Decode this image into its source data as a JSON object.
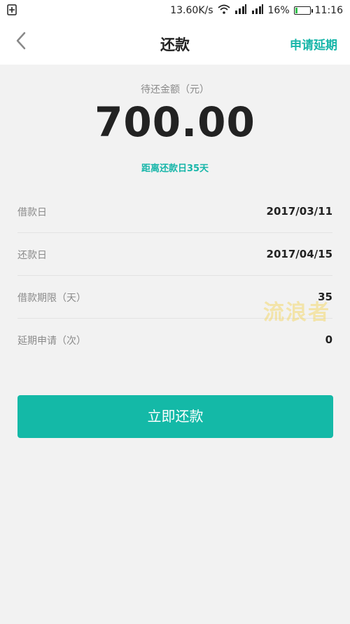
{
  "status_bar": {
    "speed": "13.60K/s",
    "battery_percent": "16%",
    "time": "11:16",
    "battery_level": 0.16
  },
  "header": {
    "title": "还款",
    "action": "申请延期",
    "back_icon": "chevron-left-icon"
  },
  "amount": {
    "label": "待还金额（元）",
    "value": "700.00",
    "due_text": "距离还款日35天"
  },
  "info": [
    {
      "label": "借款日",
      "value": "2017/03/11"
    },
    {
      "label": "还款日",
      "value": "2017/04/15"
    },
    {
      "label": "借款期限（天）",
      "value": "35"
    },
    {
      "label": "延期申请（次）",
      "value": "0"
    }
  ],
  "button": {
    "label": "立即还款"
  },
  "watermark": "流浪者",
  "colors": {
    "accent": "#17b6a9",
    "button": "#14b9a7",
    "background": "#f2f2f2"
  }
}
